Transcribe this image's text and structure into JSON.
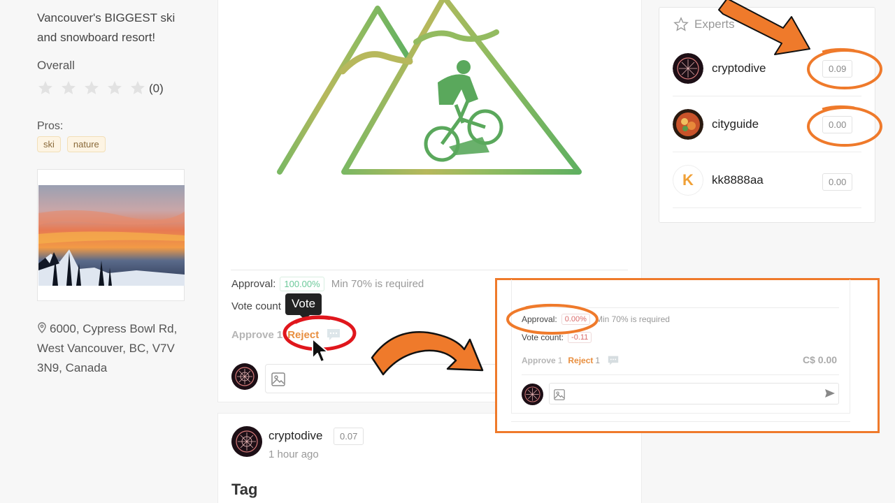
{
  "place": {
    "description": "Vancouver's BIGGEST ski and snowboard resort!",
    "overall_label": "Overall",
    "rating_count": "(0)",
    "pros_label": "Pros:",
    "pros": [
      "ski",
      "nature"
    ],
    "address": "6000, Cypress Bowl Rd, West Vancouver, BC, V7V 3N9, Canada"
  },
  "voting": {
    "approval_label": "Approval:",
    "approval_value": "100.00%",
    "min_required": "Min 70% is required",
    "vote_count_label": "Vote count",
    "tooltip": "Vote",
    "approve_label": "Approve",
    "approve_count": "1",
    "reject_label": "Reject"
  },
  "post": {
    "username": "cryptodive",
    "score": "0.07",
    "time": "1 hour ago",
    "section_title": "Tag"
  },
  "experts": {
    "title": "Experts",
    "items": [
      {
        "name": "cryptodive",
        "score": "0.09"
      },
      {
        "name": "cityguide",
        "score": "0.00"
      },
      {
        "name": "kk8888aa",
        "score": "0.00",
        "initial": "K"
      }
    ]
  },
  "inset": {
    "approval_label": "Approval:",
    "approval_value": "0.00%",
    "min_required": "Min 70% is required",
    "vote_count_label": "Vote count:",
    "vote_count_value": "-0.11",
    "approve_label": "Approve",
    "approve_count": "1",
    "reject_label": "Reject",
    "reject_count": "1",
    "amount": "C$ 0.00"
  },
  "colors": {
    "accent_orange": "#ef7a2b",
    "reject_orange": "#e88e3e",
    "approval_green": "#6cc99a",
    "highlight_red": "#e0161c"
  }
}
